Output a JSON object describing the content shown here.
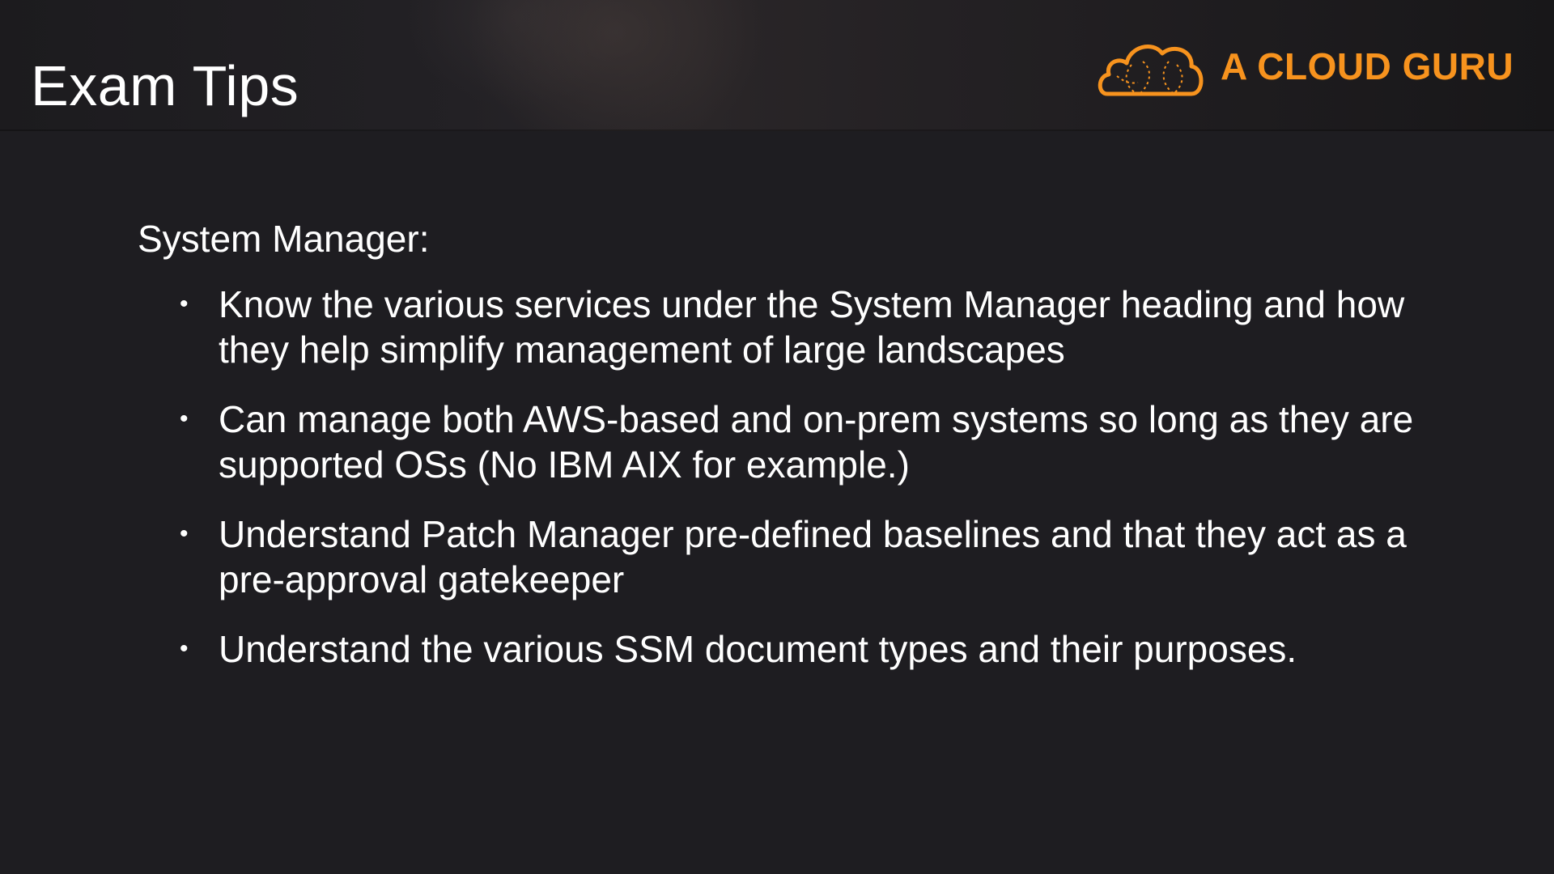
{
  "header": {
    "title": "Exam Tips",
    "brand": {
      "name": "A CLOUD GURU",
      "logo_icon": "cloud-logo-icon",
      "color": "#f7931e"
    }
  },
  "content": {
    "heading": "System Manager:",
    "bullet_glyph": "•",
    "tips": [
      "Know the various services under the System Manager heading and how they help simplify management of large landscapes",
      "Can manage both AWS-based and on-prem systems so long as they are supported OSs (No IBM AIX for example.)",
      "Understand Patch Manager pre-defined baselines and that they act as a pre-approval gatekeeper",
      "Understand the various SSM document types and their purposes."
    ]
  },
  "colors": {
    "background": "#1e1d21",
    "text": "#ffffff",
    "accent": "#f7931e"
  }
}
